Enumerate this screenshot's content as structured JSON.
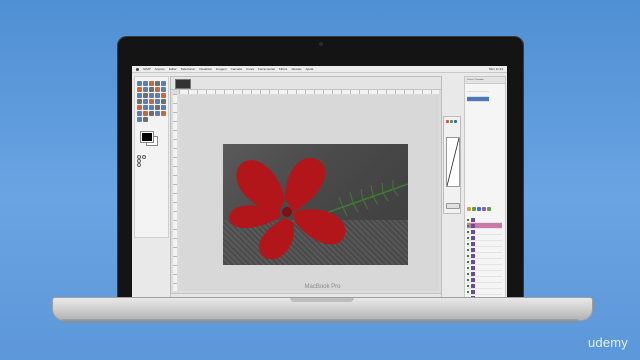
{
  "laptop": {
    "brand_label": "MacBook Pro"
  },
  "watermark": {
    "text": "udemy"
  },
  "menubar": {
    "items": [
      "GIMP",
      "Arquivo",
      "Editar",
      "Selecionar",
      "Visualizar",
      "Imagem",
      "Camada",
      "Cores",
      "Ferramentas",
      "Filtros",
      "Janelas",
      "Ajuda"
    ],
    "status": "Mon 11:24"
  },
  "image_window": {
    "status_text": "px   flor_vermelha.jpg"
  },
  "right_panel": {
    "title": "Pincéis / Camadas"
  },
  "colors": {
    "background": "#5c97d9",
    "lid": "#141414",
    "accent_layer": "#c97aa7",
    "flower_red": "#b3161a",
    "leaf_green": "#3f7a32"
  }
}
